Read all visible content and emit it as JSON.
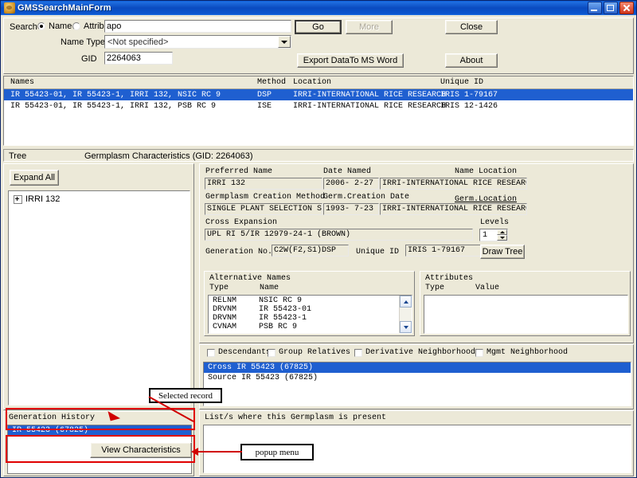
{
  "window": {
    "title": "GMSSearchMainForm",
    "icon": "app-icon",
    "minimize": "minimize-icon",
    "maximize": "restore-icon",
    "close": "close-icon"
  },
  "search": {
    "label": "Search",
    "radio_name": "Name",
    "radio_attribute": "Attribute",
    "selected": "Name",
    "query_value": "apo",
    "name_type_label": "Name Type",
    "name_type_value": "<Not specified>",
    "gid_label": "GID",
    "gid_value": "2264063",
    "go_button": "Go",
    "more_button": "More",
    "export_button": "Export DataTo MS Word",
    "close_button": "Close",
    "about_button": "About"
  },
  "results": {
    "columns": [
      "Names",
      "Method",
      "Location",
      "Unique ID"
    ],
    "rows": [
      {
        "names": "IR 55423-01, IR 55423-1, IRRI 132, NSIC RC 9",
        "method": "DSP",
        "location": "IRRI-INTERNATIONAL RICE RESEARCH",
        "unique_id": "IRIS 1-79167",
        "selected": true
      },
      {
        "names": "IR 55423-01, IR 55423-1, IRRI 132, PSB RC 9",
        "method": "ISE",
        "location": "IRRI-INTERNATIONAL RICE RESEARCH",
        "unique_id": "IRIS 12-1426",
        "selected": false
      }
    ]
  },
  "tabs": {
    "tree_tab": "Tree",
    "characteristics_tab": "Germplasm Characteristics (GID: 2264063)"
  },
  "tree": {
    "expand_all_button": "Expand All",
    "node_label": "IRRI 132",
    "expander": "plus-icon"
  },
  "details": {
    "preferred_name_label": "Preferred Name",
    "preferred_name_value": "IRRI 132",
    "date_named_label": "Date Named",
    "date_named_value": "2006- 2-27",
    "name_location_label": "Name Location",
    "name_location_value": "IRRI-INTERNATIONAL RICE RESEARC",
    "creation_method_label": "Germplasm Creation Method",
    "creation_method_value": "SINGLE PLANT SELECTION SF",
    "creation_date_label": "Germ.Creation Date",
    "creation_date_value": "1993- 7-23",
    "germ_location_label": "Germ.Location",
    "germ_location_value": "IRRI-INTERNATIONAL RICE RESEARC",
    "cross_expansion_label": "Cross Expansion",
    "cross_expansion_value": "UPL RI 5/IR 12979-24-1 (BROWN)",
    "levels_label": "Levels",
    "levels_value": "1",
    "generation_no_label": "Generation No.",
    "generation_no_value": "C2W(F2,S1)DSP",
    "unique_id_label": "Unique ID",
    "unique_id_value": "IRIS 1-79167",
    "draw_tree_button": "Draw Tree"
  },
  "alt_names": {
    "title": "Alternative Names",
    "col_type": "Type",
    "col_name": "Name",
    "rows": [
      {
        "type": "RELNM",
        "name": "NSIC RC 9"
      },
      {
        "type": "DRVNM",
        "name": "IR 55423-01"
      },
      {
        "type": "DRVNM",
        "name": "IR 55423-1"
      },
      {
        "type": "CVNAM",
        "name": "PSB RC 9"
      }
    ]
  },
  "attributes": {
    "title": "Attributes",
    "col_type": "Type",
    "col_value": "Value",
    "rows": []
  },
  "relations": {
    "checkboxes": [
      {
        "label": "Descendants",
        "checked": false
      },
      {
        "label": "Group Relatives",
        "checked": false
      },
      {
        "label": "Derivative Neighborhood",
        "checked": false
      },
      {
        "label": "Mgmt Neighborhood",
        "checked": false
      }
    ],
    "rows": [
      {
        "text": "Cross  IR 55423 (67825)",
        "selected": true
      },
      {
        "text": "Source IR 55423 (67825)",
        "selected": false
      }
    ]
  },
  "generation_history": {
    "title": "Generation History",
    "rows": [
      {
        "text": "IR 55423 (67825)",
        "selected": true
      }
    ],
    "view_characteristics_button": "View Characteristics"
  },
  "lists_panel": {
    "title": "List/s where this Germplasm is present"
  },
  "annotations": [
    {
      "text": "Selected record"
    },
    {
      "text": "popup menu"
    }
  ],
  "colors": {
    "selection_blue": "#1f5fd0",
    "annotation_red": "#d00000",
    "window_face": "#ece9d8",
    "titlebar_blue": "#0a4bc0"
  }
}
